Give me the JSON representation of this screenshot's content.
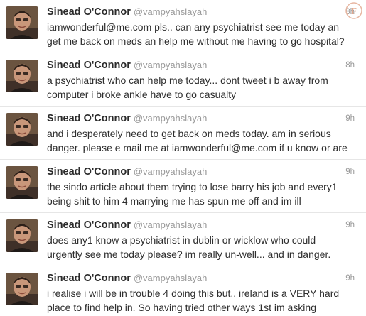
{
  "tweets": [
    {
      "name": "Sinead O'Connor",
      "handle": "@vampyahslayah",
      "time": "8h",
      "lines": [
        "iamwonderful@me.com pls.. can any psychiatrist see me today an",
        "get me back on meds an help me without me having to go hospital?"
      ]
    },
    {
      "name": "Sinead O'Connor",
      "handle": "@vampyahslayah",
      "time": "8h",
      "lines": [
        "a psychiatrist who can help me today... dont tweet i b away from",
        "computer i broke ankle have to go casualty"
      ]
    },
    {
      "name": "Sinead O'Connor",
      "handle": "@vampyahslayah",
      "time": "9h",
      "lines": [
        "and i desperately need to get back on meds today. am in serious",
        "danger. please e mail me at iamwonderful@me.com if u know or are"
      ]
    },
    {
      "name": "Sinead O'Connor",
      "handle": "@vampyahslayah",
      "time": "9h",
      "lines": [
        "the sindo article about them trying to lose barry his job and every1",
        "being shit to him 4 marrying me has spun me off and im ill"
      ]
    },
    {
      "name": "Sinead O'Connor",
      "handle": "@vampyahslayah",
      "time": "9h",
      "lines": [
        "does any1 know a psychiatrist in dublin or wicklow who could",
        "urgently see me today please? im really un-well... and in danger."
      ]
    },
    {
      "name": "Sinead O'Connor",
      "handle": "@vampyahslayah",
      "time": "9h",
      "lines": [
        "i realise i will be in trouble 4 doing this but.. ireland is a VERY hard",
        "place to find help in. So having tried other ways 1st im asking"
      ]
    }
  ],
  "icons": {
    "watermark": "watermark-logo-icon",
    "avatar": "profile-photo"
  },
  "colors": {
    "name": "#2a2a2a",
    "secondary": "#999999",
    "body_text": "#2e2e2e",
    "divider": "#e6e6e6"
  }
}
